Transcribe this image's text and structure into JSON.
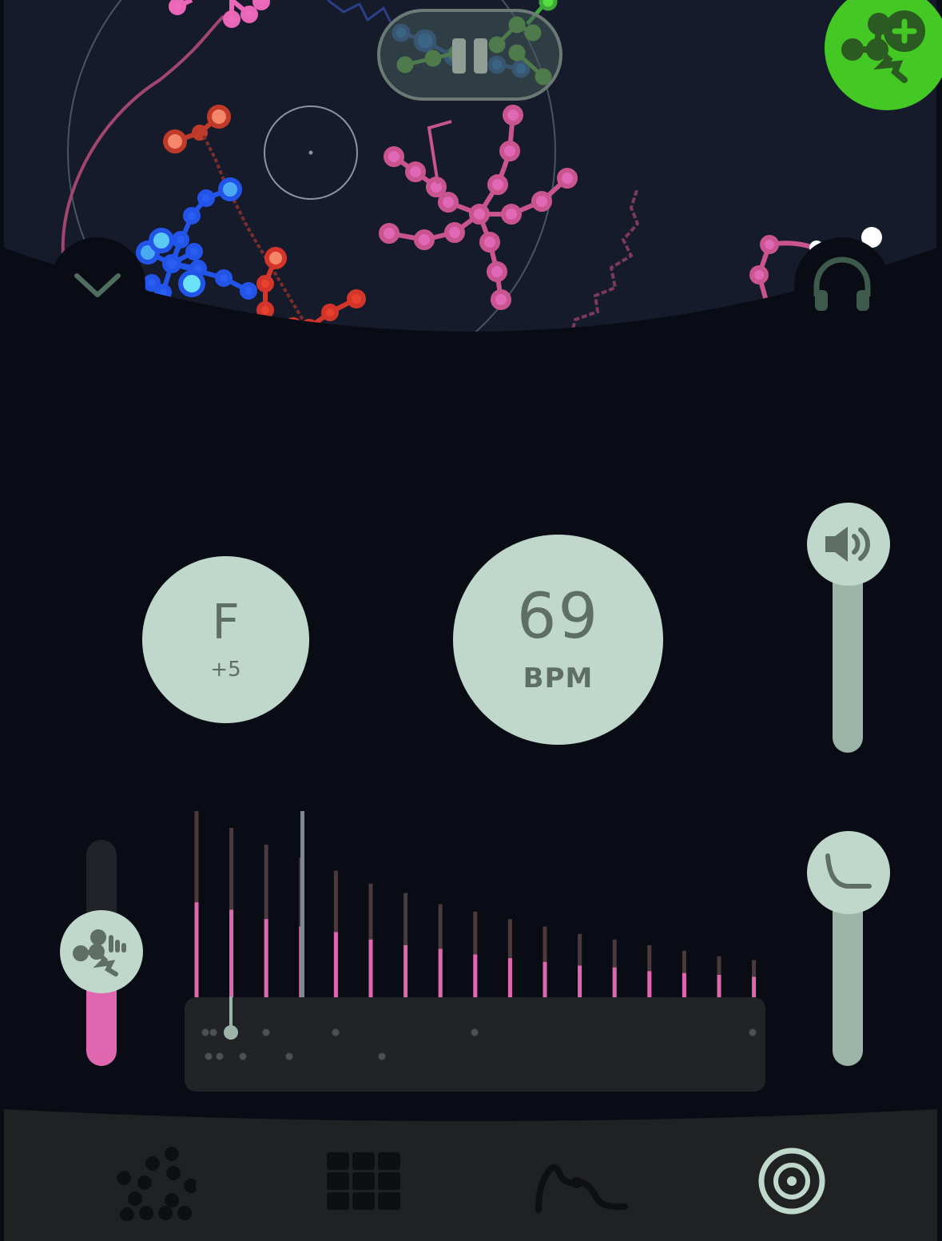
{
  "visualizer": {
    "pause_icon": "pause-icon",
    "add_icon": "add-molecule-icon",
    "collapse_icon": "chevron-down-icon",
    "headphones_icon": "headphones-icon",
    "accent_green": "#44c924"
  },
  "key_control": {
    "letter": "F",
    "offset": "+5"
  },
  "tempo_control": {
    "value": "69",
    "unit": "BPM"
  },
  "volume_slider": {
    "icon": "speaker-icon",
    "level": 1.0
  },
  "decay_slider": {
    "icon": "decay-curve-icon",
    "level": 1.0
  },
  "intensity_slider": {
    "icon": "molecule-wave-icon",
    "level": 0.48,
    "color": "#e066b0"
  },
  "harmonics": {
    "bar_color": "#e066b0",
    "track_color": "#4a3a3c",
    "bars": [
      {
        "total": 1.0,
        "filled": 0.51
      },
      {
        "total": 0.91,
        "filled": 0.47
      },
      {
        "total": 0.82,
        "filled": 0.42
      },
      {
        "total": 0.75,
        "filled": 0.38
      },
      {
        "total": 0.68,
        "filled": 0.35
      },
      {
        "total": 0.61,
        "filled": 0.31
      },
      {
        "total": 0.56,
        "filled": 0.28
      },
      {
        "total": 0.5,
        "filled": 0.26
      },
      {
        "total": 0.46,
        "filled": 0.23
      },
      {
        "total": 0.42,
        "filled": 0.21
      },
      {
        "total": 0.38,
        "filled": 0.19
      },
      {
        "total": 0.34,
        "filled": 0.17
      },
      {
        "total": 0.31,
        "filled": 0.16
      },
      {
        "total": 0.28,
        "filled": 0.14
      },
      {
        "total": 0.25,
        "filled": 0.13
      },
      {
        "total": 0.22,
        "filled": 0.12
      },
      {
        "total": 0.2,
        "filled": 0.11
      }
    ]
  },
  "bottom_nav": {
    "items": [
      {
        "icon": "dots-cluster-icon",
        "active": false
      },
      {
        "icon": "grid-icon",
        "active": false
      },
      {
        "icon": "curve-line-icon",
        "active": false
      },
      {
        "icon": "target-icon",
        "active": true
      }
    ]
  }
}
